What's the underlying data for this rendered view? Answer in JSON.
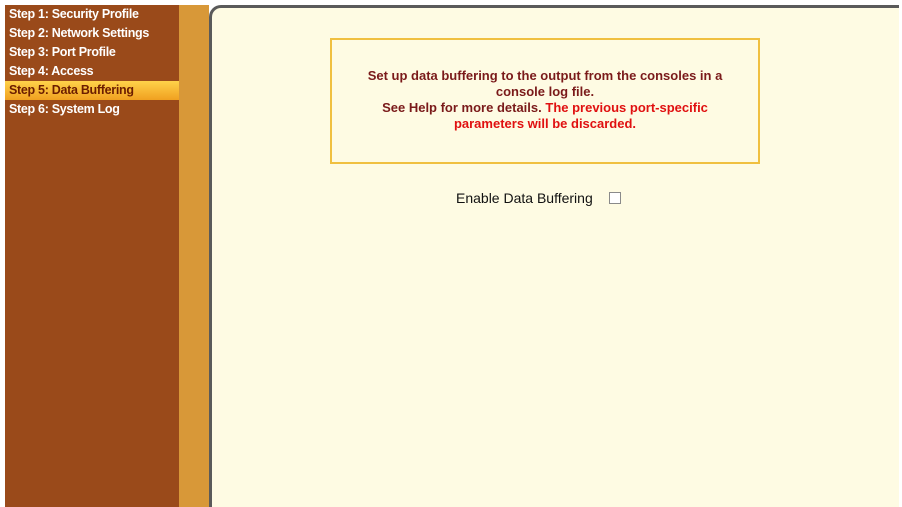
{
  "sidebar": {
    "items": [
      {
        "label": "Step 1: Security Profile",
        "active": false
      },
      {
        "label": "Step 2: Network Settings",
        "active": false
      },
      {
        "label": "Step 3: Port Profile",
        "active": false
      },
      {
        "label": "Step 4: Access",
        "active": false
      },
      {
        "label": "Step 5: Data Buffering",
        "active": true
      },
      {
        "label": "Step 6: System Log",
        "active": false
      }
    ]
  },
  "notice": {
    "line1": "Set up data buffering to the output from the consoles in a",
    "line2": "console log file.",
    "line3_normal": "See Help for more details.",
    "line3_warning": "The previous port-specific",
    "line4_warning": "parameters will be discarded."
  },
  "form": {
    "enable_label": "Enable Data Buffering",
    "enable_checked": false
  },
  "colors": {
    "sidebar_bg": "#9a4a1a",
    "divider_bg": "#d89838",
    "content_bg": "#fefbe3",
    "notice_border": "#f0c040",
    "notice_text": "#7a1a1a",
    "warning_text": "#e01010"
  }
}
